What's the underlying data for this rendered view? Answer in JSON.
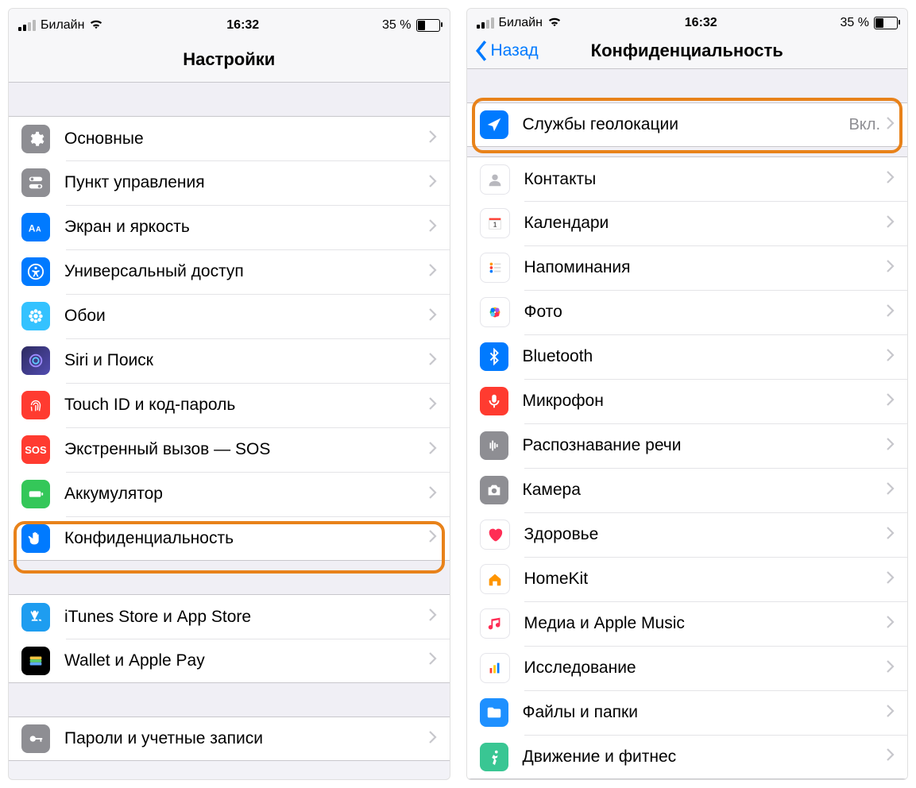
{
  "status": {
    "carrier": "Билайн",
    "time": "16:32",
    "battery": "35 %"
  },
  "screen1": {
    "title": "Настройки",
    "group1": [
      {
        "label": "Основные"
      },
      {
        "label": "Пункт управления"
      },
      {
        "label": "Экран и яркость"
      },
      {
        "label": "Универсальный доступ"
      },
      {
        "label": "Обои"
      },
      {
        "label": "Siri и Поиск"
      },
      {
        "label": "Touch ID и код-пароль"
      },
      {
        "label": "Экстренный вызов — SOS",
        "sos": "SOS"
      },
      {
        "label": "Аккумулятор"
      },
      {
        "label": "Конфиденциальность"
      }
    ],
    "group2": [
      {
        "label": "iTunes Store и App Store"
      },
      {
        "label": "Wallet и Apple Pay"
      }
    ],
    "group3": [
      {
        "label": "Пароли и учетные записи"
      }
    ]
  },
  "screen2": {
    "back": "Назад",
    "title": "Конфиденциальность",
    "group1": [
      {
        "label": "Службы геолокации",
        "value": "Вкл."
      }
    ],
    "group2": [
      {
        "label": "Контакты"
      },
      {
        "label": "Календари"
      },
      {
        "label": "Напоминания"
      },
      {
        "label": "Фото"
      },
      {
        "label": "Bluetooth"
      },
      {
        "label": "Микрофон"
      },
      {
        "label": "Распознавание речи"
      },
      {
        "label": "Камера"
      },
      {
        "label": "Здоровье"
      },
      {
        "label": "HomeKit"
      },
      {
        "label": "Медиа и Apple Music"
      },
      {
        "label": "Исследование"
      },
      {
        "label": "Файлы и папки"
      },
      {
        "label": "Движение и фитнес"
      }
    ]
  }
}
